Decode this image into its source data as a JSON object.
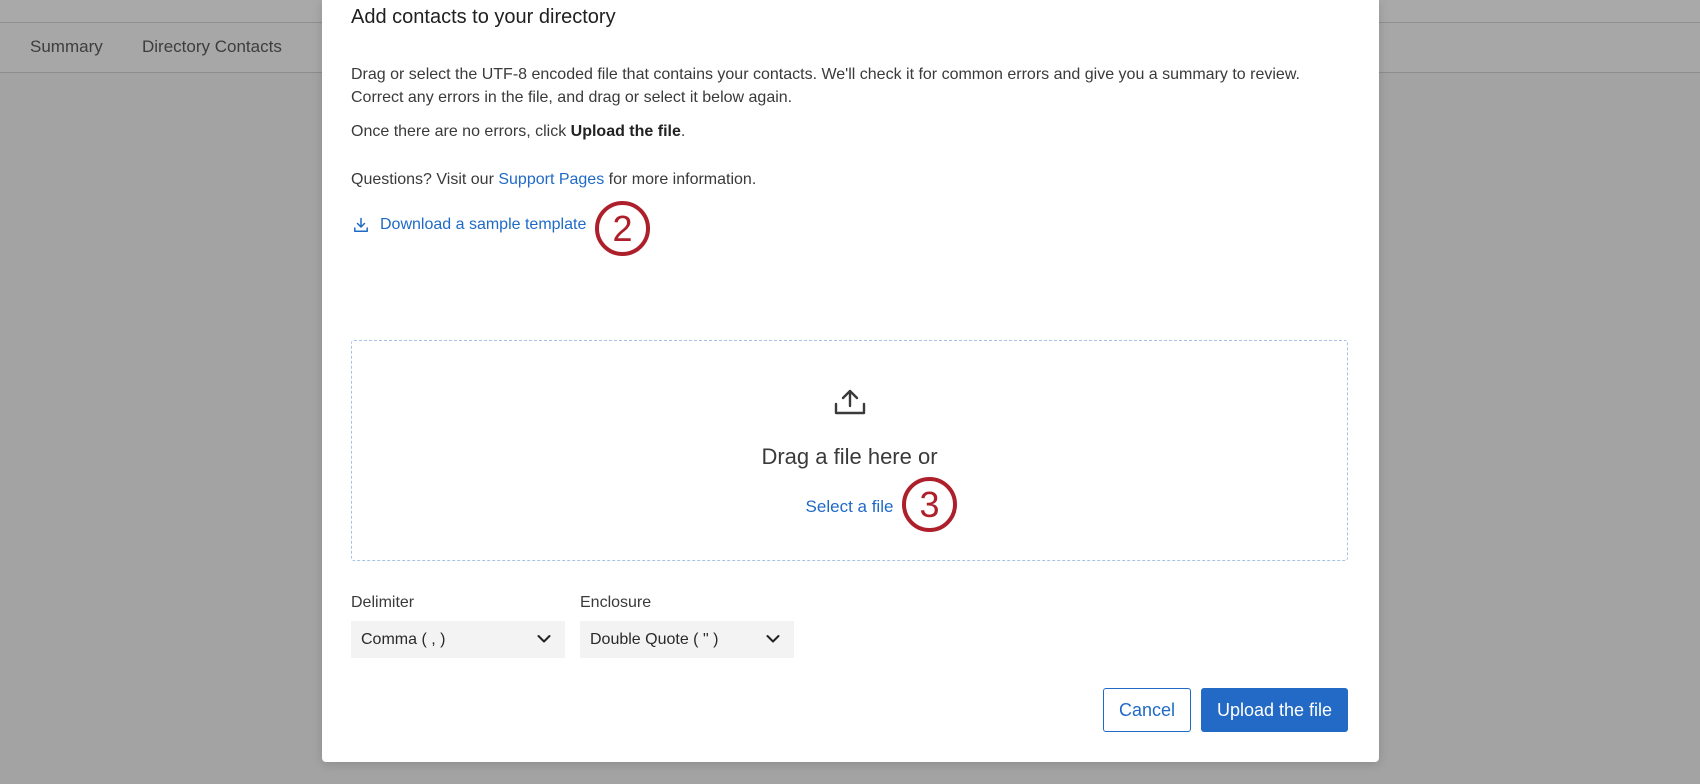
{
  "background": {
    "tabs": [
      {
        "label": "Summary"
      },
      {
        "label": "Directory Contacts"
      }
    ]
  },
  "modal": {
    "title": "Add contacts to your directory",
    "instructions": "Drag or select the UTF-8 encoded file that contains your contacts. We'll check it for common errors and give you a summary to review. Correct any errors in the file, and drag or select it below again.",
    "errors_prefix": "Once there are no errors, click ",
    "errors_bold": "Upload the file",
    "errors_suffix": ".",
    "questions_prefix": "Questions? Visit our ",
    "support_link": "Support Pages",
    "questions_suffix": " for more information.",
    "download_link": "Download a sample template",
    "dropzone": {
      "drag_text": "Drag a file here or",
      "select_link": "Select a file"
    },
    "delimiter": {
      "label": "Delimiter",
      "value": "Comma ( , )"
    },
    "enclosure": {
      "label": "Enclosure",
      "value": "Double Quote ( \" )"
    },
    "buttons": {
      "cancel": "Cancel",
      "upload": "Upload the file"
    }
  },
  "callouts": [
    {
      "number": "2"
    },
    {
      "number": "3"
    }
  ],
  "colors": {
    "accent": "#1f6ac7",
    "callout": "#ad1f2a",
    "overlay": "#a3a3a3"
  },
  "icons": {
    "download": "download-icon",
    "upload": "upload-icon",
    "chevron": "chevron-down-icon"
  }
}
